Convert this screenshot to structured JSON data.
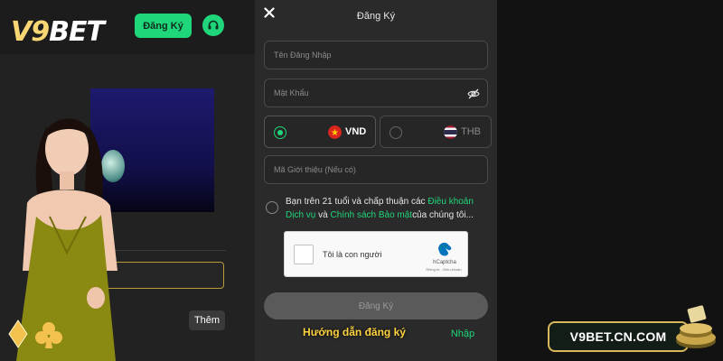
{
  "header": {
    "logo_text_v9": "V9",
    "logo_text_bet": "BET",
    "signup_label": "Đăng Ký",
    "support_icon": "headset-icon"
  },
  "background": {
    "more_label": "Thêm"
  },
  "modal": {
    "title": "Đăng Ký",
    "close_icon": "close-icon",
    "username_placeholder": "Tên Đăng Nhập",
    "password_placeholder": "Mật Khẩu",
    "currencies": [
      {
        "code": "VND",
        "selected": true
      },
      {
        "code": "THB",
        "selected": false
      }
    ],
    "referral_placeholder": "Mã Giới thiệu (Nếu có)",
    "agree": {
      "prefix": "Bạn trên 21 tuổi và chấp thuận các ",
      "terms_link": "Điều khoản Dịch vụ",
      "middle": " và ",
      "privacy_link": "Chính sách Bảo mật",
      "suffix": "của chúng tôi..."
    },
    "captcha": {
      "label": "Tôi là con người",
      "brand": "hCaptcha",
      "links": "Riêng tư - Điều khoản"
    },
    "submit_label": "Đăng Ký",
    "login_hint_green": "Nhập"
  },
  "caption": "Hướng dẫn đăng ký",
  "badge": "V9BET.CN.COM",
  "colors": {
    "accent": "#1fd67a",
    "gold": "#ffd23f",
    "modal_bg": "#2a2a2a"
  }
}
